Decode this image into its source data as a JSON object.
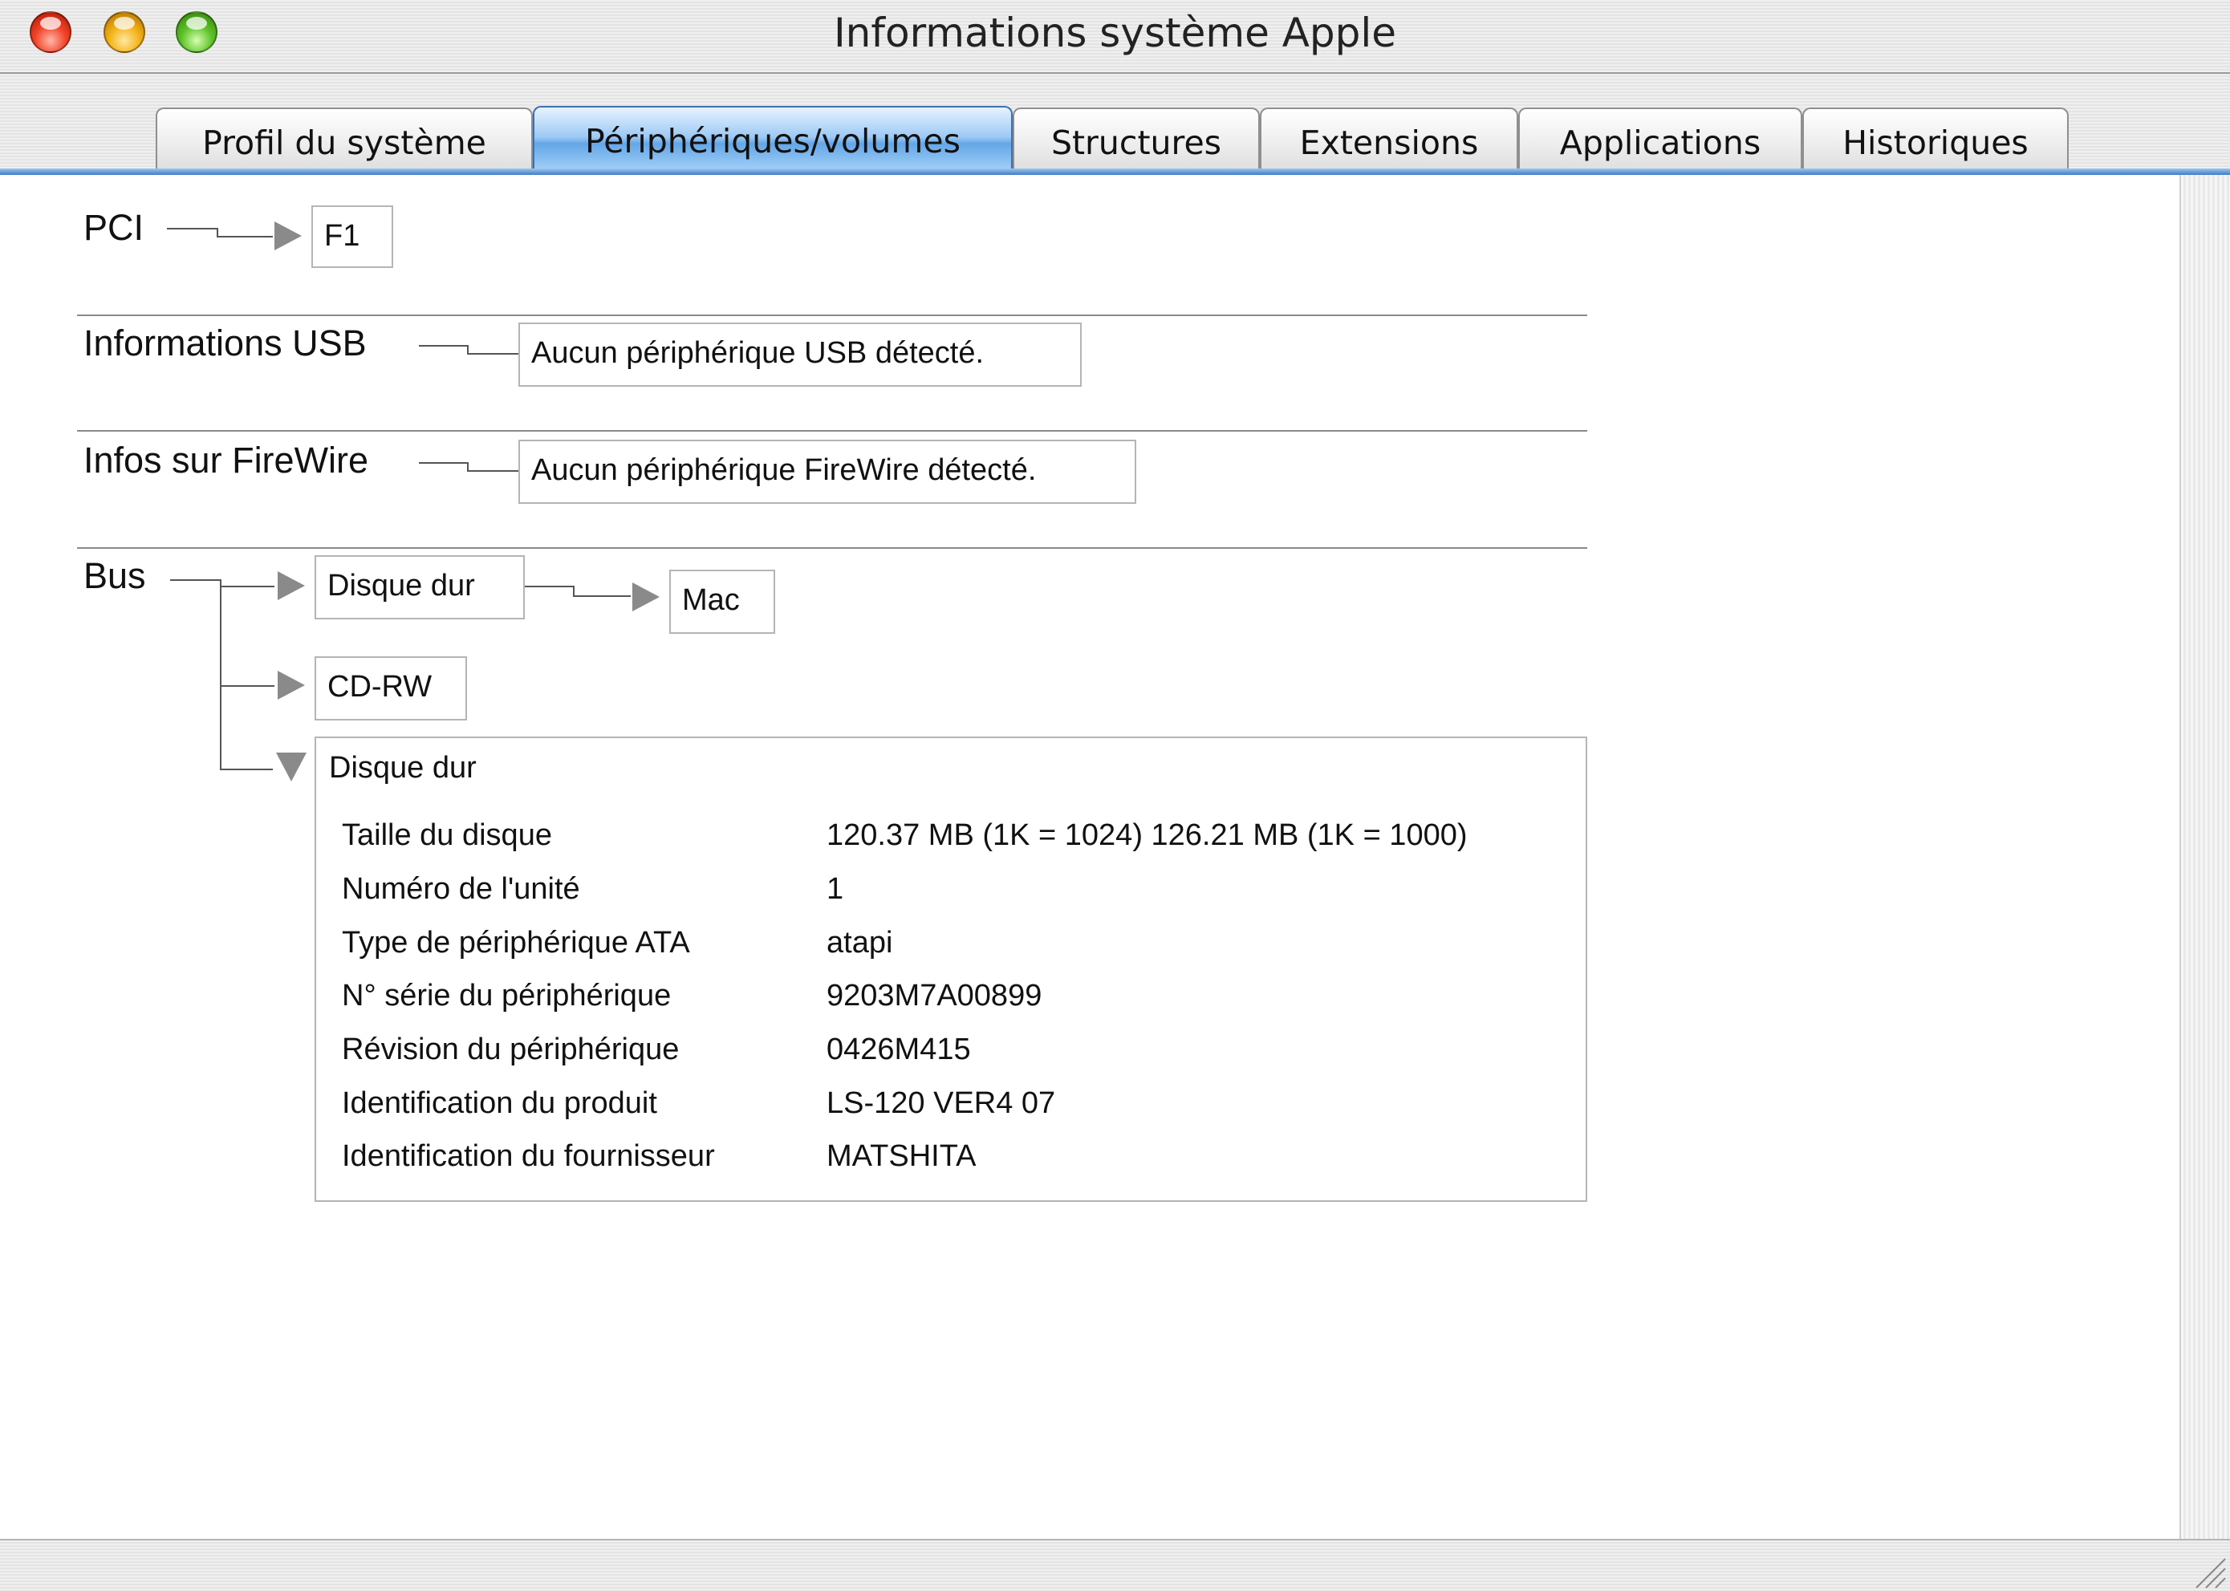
{
  "window": {
    "title": "Informations système Apple"
  },
  "tabs": [
    {
      "label": "Profil du système",
      "active": false
    },
    {
      "label": "Périphériques/volumes",
      "active": true
    },
    {
      "label": "Structures",
      "active": false
    },
    {
      "label": "Extensions",
      "active": false
    },
    {
      "label": "Applications",
      "active": false
    },
    {
      "label": "Historiques",
      "active": false
    }
  ],
  "pci": {
    "label": "PCI",
    "items": [
      "F1"
    ]
  },
  "usb": {
    "label": "Informations USB",
    "message": "Aucun périphérique USB détecté."
  },
  "firewire": {
    "label": "Infos sur FireWire",
    "message": "Aucun périphérique FireWire détecté."
  },
  "bus": {
    "label": "Bus",
    "devices": [
      {
        "label": "Disque dur",
        "expanded": false,
        "children": [
          "Mac"
        ]
      },
      {
        "label": "CD-RW",
        "expanded": false
      },
      {
        "label": "Disque dur",
        "expanded": true,
        "details": [
          {
            "key": "Taille du disque",
            "value": "120.37 MB (1K = 1024)  126.21 MB (1K = 1000)"
          },
          {
            "key": "Numéro de l'unité",
            "value": "1"
          },
          {
            "key": "Type de périphérique ATA",
            "value": "atapi"
          },
          {
            "key": "N° série du périphérique",
            "value": "9203M7A00899"
          },
          {
            "key": "Révision du périphérique",
            "value": "0426M415"
          },
          {
            "key": "Identification du produit",
            "value": "LS-120 VER4   07"
          },
          {
            "key": "Identification du fournisseur",
            "value": "MATSHITA"
          }
        ]
      }
    ]
  },
  "icons": {
    "close": "close-light",
    "minimize": "minimize-light",
    "zoom": "zoom-light",
    "expand": "disclosure-triangle-right",
    "collapse": "disclosure-triangle-down",
    "resize": "resize-grip"
  }
}
